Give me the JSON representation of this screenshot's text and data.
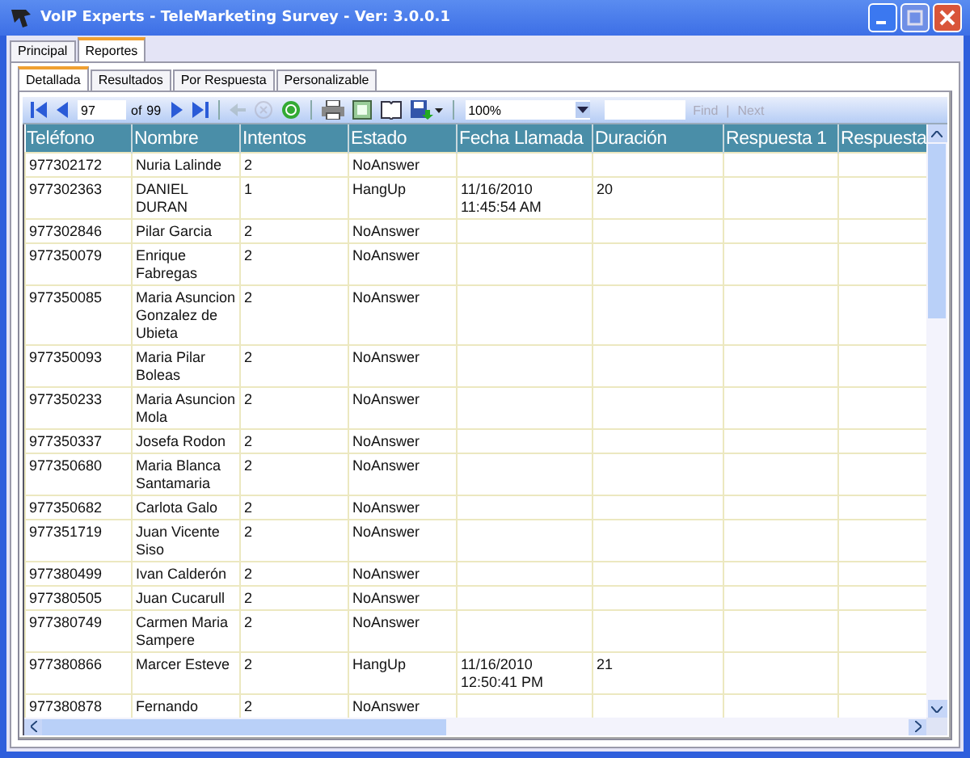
{
  "window": {
    "title": "VoIP Experts - TeleMarketing Survey - Ver: 3.0.0.1"
  },
  "outer_tabs": [
    {
      "label": "Principal",
      "selected": false
    },
    {
      "label": "Reportes",
      "selected": true
    }
  ],
  "inner_tabs": [
    {
      "label": "Detallada",
      "selected": true
    },
    {
      "label": "Resultados",
      "selected": false
    },
    {
      "label": "Por Respuesta",
      "selected": false
    },
    {
      "label": "Personalizable",
      "selected": false
    }
  ],
  "toolbar": {
    "buttons": [
      {
        "kind": "first",
        "disabled": false
      },
      {
        "kind": "prev",
        "disabled": false
      },
      {
        "kind": "page"
      },
      {
        "kind": "next",
        "disabled": false
      },
      {
        "kind": "last",
        "disabled": false
      },
      {
        "kind": "sep"
      },
      {
        "kind": "back",
        "disabled": true
      },
      {
        "kind": "stop",
        "disabled": true
      },
      {
        "kind": "refresh",
        "disabled": false
      },
      {
        "kind": "sep"
      },
      {
        "kind": "print",
        "disabled": false
      },
      {
        "kind": "layout",
        "disabled": false
      },
      {
        "kind": "setup",
        "disabled": false
      },
      {
        "kind": "export",
        "disabled": false
      },
      {
        "kind": "sep"
      },
      {
        "kind": "zoom"
      },
      {
        "kind": "find"
      }
    ],
    "page": "97",
    "of_label": "of",
    "total": "99",
    "zoom": "100%",
    "find_label": "Find",
    "find_separator": "|",
    "next_label": "Next",
    "find_disabled": true
  },
  "table": {
    "columns": [
      "Teléfono",
      "Nombre",
      "Intentos",
      "Estado",
      "Fecha Llamada",
      "Duración",
      "Respuesta 1",
      "Respuesta"
    ],
    "rows": [
      {
        "phone": "977302172",
        "name": "Nuria Lalinde",
        "attempts": "2",
        "status": "NoAnswer"
      },
      {
        "phone": "977302363",
        "name": "DANIEL DURAN",
        "attempts": "1",
        "status": "HangUp",
        "date": "11/16/2010 11:45:54 AM",
        "duration": "20"
      },
      {
        "phone": "977302846",
        "name": "Pilar Garcia",
        "attempts": "2",
        "status": "NoAnswer"
      },
      {
        "phone": "977350079",
        "name": "Enrique Fabregas",
        "attempts": "2",
        "status": "NoAnswer"
      },
      {
        "phone": "977350085",
        "name": "Maria Asuncion Gonzalez de Ubieta",
        "attempts": "2",
        "status": "NoAnswer"
      },
      {
        "phone": "977350093",
        "name": "Maria Pilar Boleas",
        "attempts": "2",
        "status": "NoAnswer"
      },
      {
        "phone": "977350233",
        "name": "Maria Asuncion Mola",
        "attempts": "2",
        "status": "NoAnswer"
      },
      {
        "phone": "977350337",
        "name": "Josefa Rodon",
        "attempts": "2",
        "status": "NoAnswer"
      },
      {
        "phone": "977350680",
        "name": "Maria Blanca Santamaria",
        "attempts": "2",
        "status": "NoAnswer"
      },
      {
        "phone": "977350682",
        "name": "Carlota Galo",
        "attempts": "2",
        "status": "NoAnswer"
      },
      {
        "phone": "977351719",
        "name": "Juan Vicente Siso",
        "attempts": "2",
        "status": "NoAnswer"
      },
      {
        "phone": "977380499",
        "name": "Ivan Calderón",
        "attempts": "2",
        "status": "NoAnswer"
      },
      {
        "phone": "977380505",
        "name": "Juan Cucarull",
        "attempts": "2",
        "status": "NoAnswer"
      },
      {
        "phone": "977380749",
        "name": "Carmen Maria Sampere",
        "attempts": "2",
        "status": "NoAnswer"
      },
      {
        "phone": "977380866",
        "name": "Marcer Esteve",
        "attempts": "2",
        "status": "HangUp",
        "date": "11/16/2010 12:50:41 PM",
        "duration": "21"
      },
      {
        "phone": "977380878",
        "name": "Fernando",
        "attempts": "2",
        "status": "NoAnswer"
      }
    ]
  }
}
